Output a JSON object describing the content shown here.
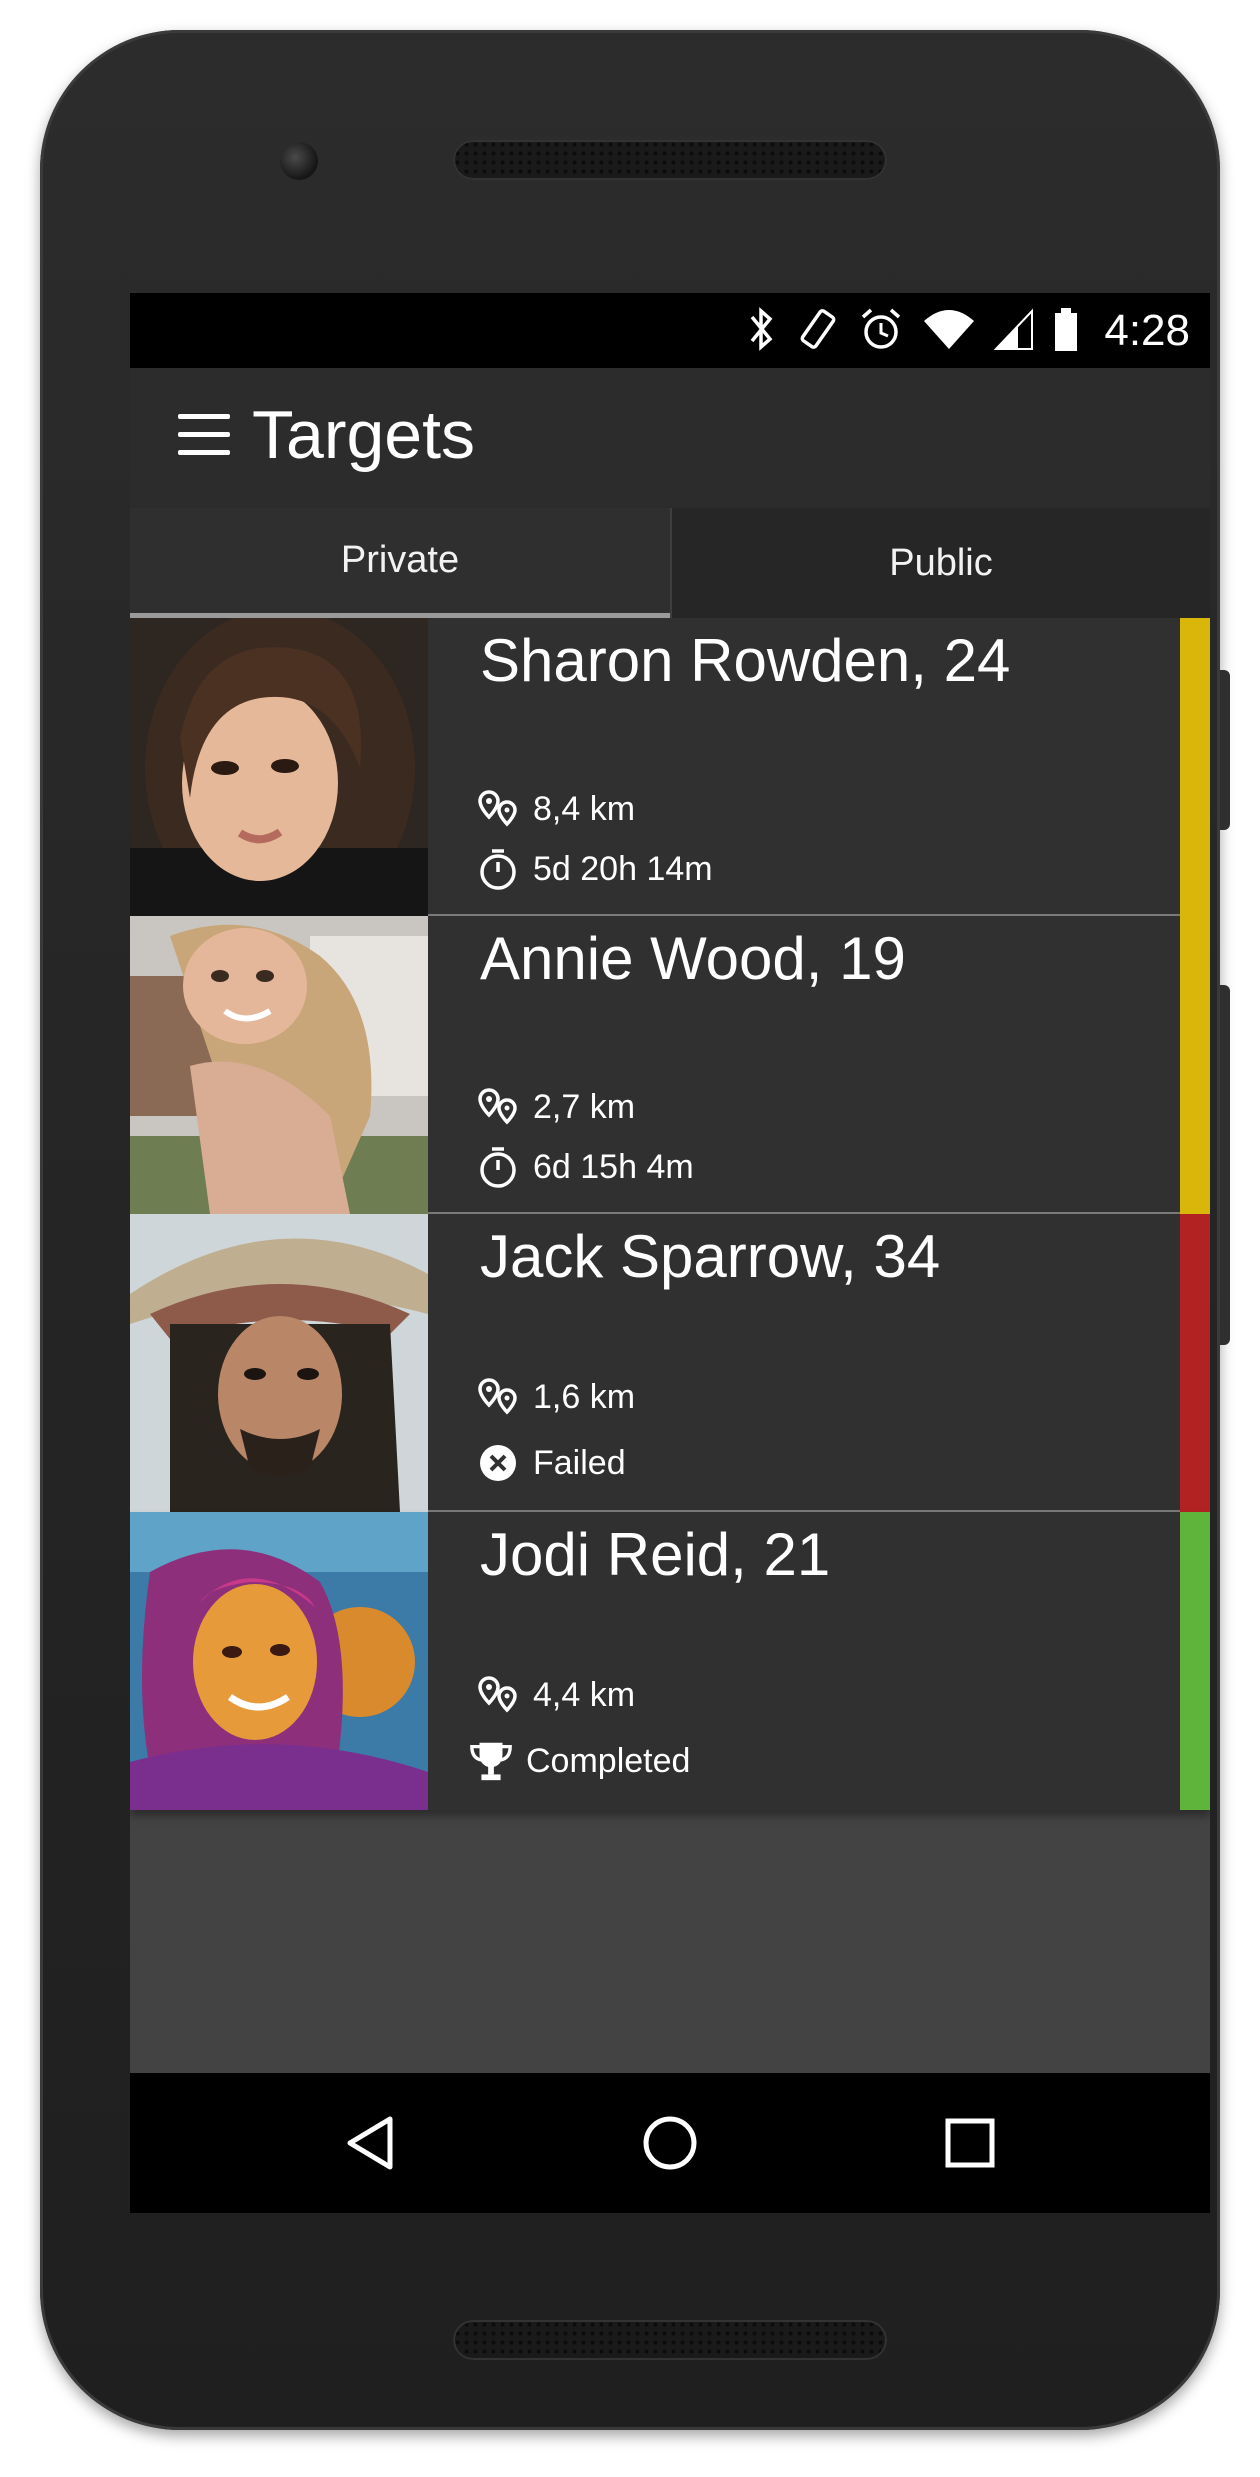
{
  "status_bar": {
    "time": "4:28",
    "icons": [
      "bluetooth-icon",
      "screen-rotation-icon",
      "alarm-icon",
      "wifi-icon",
      "cell-signal-icon",
      "battery-icon"
    ]
  },
  "app_bar": {
    "menu_icon": "menu-icon",
    "title": "Targets"
  },
  "tabs": [
    {
      "label": "Private",
      "selected": true
    },
    {
      "label": "Public",
      "selected": false
    }
  ],
  "targets": [
    {
      "name": "Sharon Rowden, 24",
      "distance": "8,4 km",
      "status_icon": "timer-icon",
      "status": "5d 20h 14m",
      "color": "#d9b70a"
    },
    {
      "name": "Annie Wood, 19",
      "distance": "2,7 km",
      "status_icon": "timer-icon",
      "status": "6d 15h 4m",
      "color": "#d9b70a"
    },
    {
      "name": "Jack Sparrow, 34",
      "distance": "1,6 km",
      "status_icon": "failed-icon",
      "status": "Failed",
      "color": "#b22222"
    },
    {
      "name": "Jodi Reid, 21",
      "distance": "4,4 km",
      "status_icon": "trophy-icon",
      "status": "Completed",
      "color": "#5fb43c"
    }
  ],
  "nav_bar": {
    "buttons": [
      "back-icon",
      "home-icon",
      "recents-icon"
    ]
  }
}
